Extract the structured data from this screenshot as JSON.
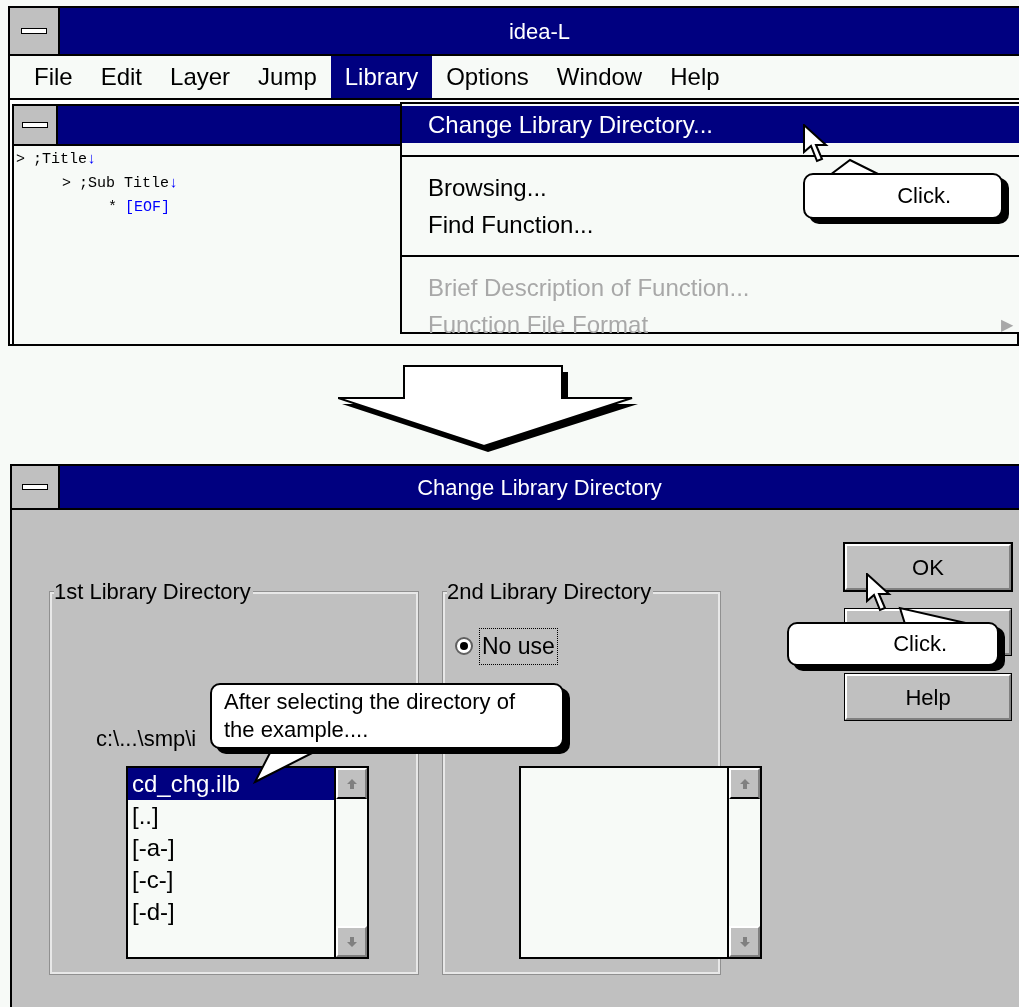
{
  "main_window": {
    "title": "idea-L",
    "menu": [
      {
        "label": "File",
        "selected": false
      },
      {
        "label": "Edit",
        "selected": false
      },
      {
        "label": "Layer",
        "selected": false
      },
      {
        "label": "Jump",
        "selected": false
      },
      {
        "label": "Library",
        "selected": true
      },
      {
        "label": "Options",
        "selected": false
      },
      {
        "label": "Window",
        "selected": false
      },
      {
        "label": "Help",
        "selected": false
      }
    ],
    "editor": {
      "lines": [
        {
          "kind": "heading",
          "marker": ">",
          "text": ";Title",
          "end": "↓",
          "children": [
            {
              "kind": "heading",
              "marker": ">",
              "text": ";Sub Title",
              "end": "↓",
              "children": [
                {
                  "kind": "eof",
                  "marker": "*",
                  "text": "[EOF]"
                }
              ]
            }
          ]
        }
      ]
    },
    "library_menu": [
      {
        "kind": "item",
        "label": "Change Library Directory...",
        "selected": true,
        "disabled": false
      },
      {
        "kind": "separator"
      },
      {
        "kind": "item",
        "label": "Browsing...",
        "selected": false,
        "disabled": false
      },
      {
        "kind": "item",
        "label": "Find Function...",
        "selected": false,
        "disabled": false
      },
      {
        "kind": "separator"
      },
      {
        "kind": "item",
        "label": "Brief Description of Function...",
        "selected": false,
        "disabled": true
      },
      {
        "kind": "submenu",
        "label": "Function File Format",
        "selected": false,
        "disabled": true,
        "arrow": "▶"
      }
    ],
    "callout": {
      "text": "Click."
    }
  },
  "dialog": {
    "title": "Change Library Directory",
    "group_1": {
      "label": "1st Library Directory",
      "path": "c:\\...\\smp\\i",
      "list": [
        {
          "label": "cd_chg.ilb",
          "selected": true
        },
        {
          "label": "[..]",
          "selected": false
        },
        {
          "label": "[-a-]",
          "selected": false
        },
        {
          "label": "[-c-]",
          "selected": false
        },
        {
          "label": "[-d-]",
          "selected": false
        }
      ]
    },
    "group_2": {
      "label": "2nd Library Directory",
      "options": [
        {
          "label": "No use",
          "selected": true
        }
      ]
    },
    "buttons": [
      {
        "kind": "default",
        "label": "OK"
      },
      {
        "kind": "covered"
      },
      {
        "kind": "normal",
        "label": "Help"
      }
    ],
    "callouts": [
      {
        "text": "After selecting the directory of the example...."
      },
      {
        "text": "Click."
      }
    ]
  }
}
